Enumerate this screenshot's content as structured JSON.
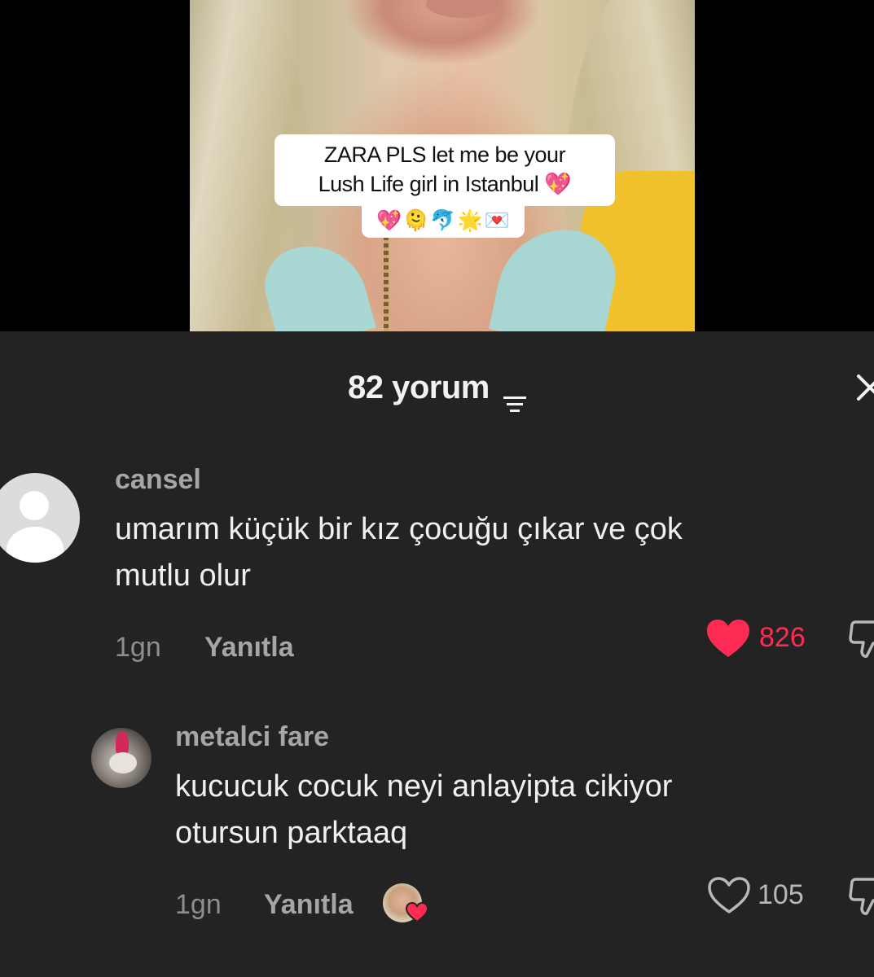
{
  "video": {
    "caption_line1": "ZARA PLS  let me be your",
    "caption_line2": "Lush Life girl in Istanbul 💖",
    "emojis": [
      "💖",
      "🫠",
      "🐬",
      "🌟",
      "💌"
    ]
  },
  "sheet": {
    "count_label": "82 yorum",
    "filter_icon": "filter-icon",
    "close_icon": "close-icon"
  },
  "comments": [
    {
      "username": "cansel",
      "text_line1": "umarım küçük bir kız çocuğu çıkar ve çok",
      "text_line2": "mutlu olur",
      "time": "1gn",
      "reply_label": "Yanıtla",
      "likes": "826",
      "liked": true
    },
    {
      "username": "metalci fare",
      "text_line1": "kucucuk cocuk neyi anlayipta cikiyor",
      "text_line2": "otursun parktaaq",
      "time": "1gn",
      "reply_label": "Yanıtla",
      "likes": "105",
      "liked": false,
      "liked_by_creator": true
    }
  ],
  "colors": {
    "background": "#232323",
    "like_active": "#fe2c55",
    "text_primary": "#f0f0f0",
    "text_secondary": "#a6a6a6"
  }
}
